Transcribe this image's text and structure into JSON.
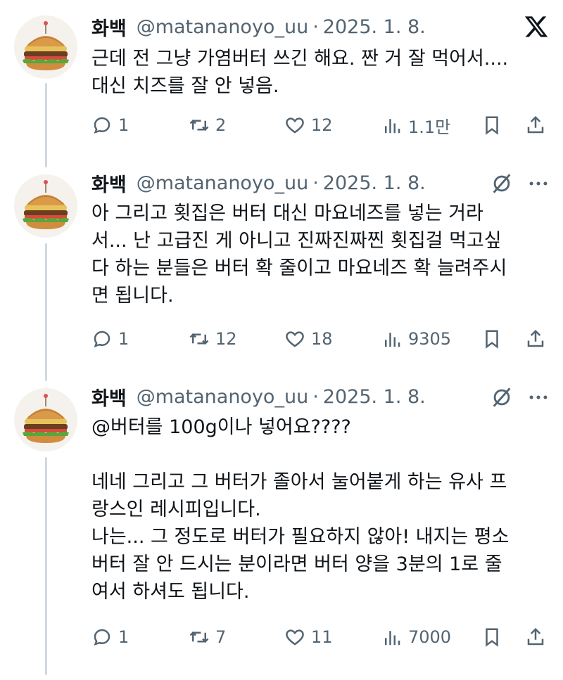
{
  "brand": {
    "logo": "x-logo-icon"
  },
  "colors": {
    "text": "#0f1419",
    "secondary": "#536471",
    "thread_line": "#cfd9de"
  },
  "tweets": [
    {
      "name": "화백",
      "handle": "@matananoyo_uu",
      "separator": "·",
      "date": "2025. 1. 8.",
      "text": "근데 전 그냥 가염버터 쓰긴 해요. 짠 거 잘 먹어서....\n대신 치즈를 잘 안 넣음.",
      "replies": "1",
      "reposts": "2",
      "likes": "12",
      "views": "1.1만"
    },
    {
      "name": "화백",
      "handle": "@matananoyo_uu",
      "separator": "·",
      "date": "2025. 1. 8.",
      "text": "아 그리고 횟집은 버터 대신 마요네즈를 넣는 거라\n서... 난 고급진 게 아니고 진짜진짜찐 횟집걸 먹고싶\n다 하는 분들은 버터 확 줄이고 마요네즈 확 늘려주시\n면 됩니다.",
      "replies": "1",
      "reposts": "12",
      "likes": "18",
      "views": "9305"
    },
    {
      "name": "화백",
      "handle": "@matananoyo_uu",
      "separator": "·",
      "date": "2025. 1. 8.",
      "text": "@버터를 100g이나 넣어요????\n\n네네 그리고 그 버터가 졸아서 눌어붙게 하는 유사 프\n랑스인 레시피입니다.\n나는... 그 정도로 버터가 필요하지 않아! 내지는 평소\n버터 잘 안 드시는 분이라면 버터 양을 3분의 1로 줄\n여서 하셔도 됩니다.",
      "replies": "1",
      "reposts": "7",
      "likes": "11",
      "views": "7000"
    }
  ]
}
